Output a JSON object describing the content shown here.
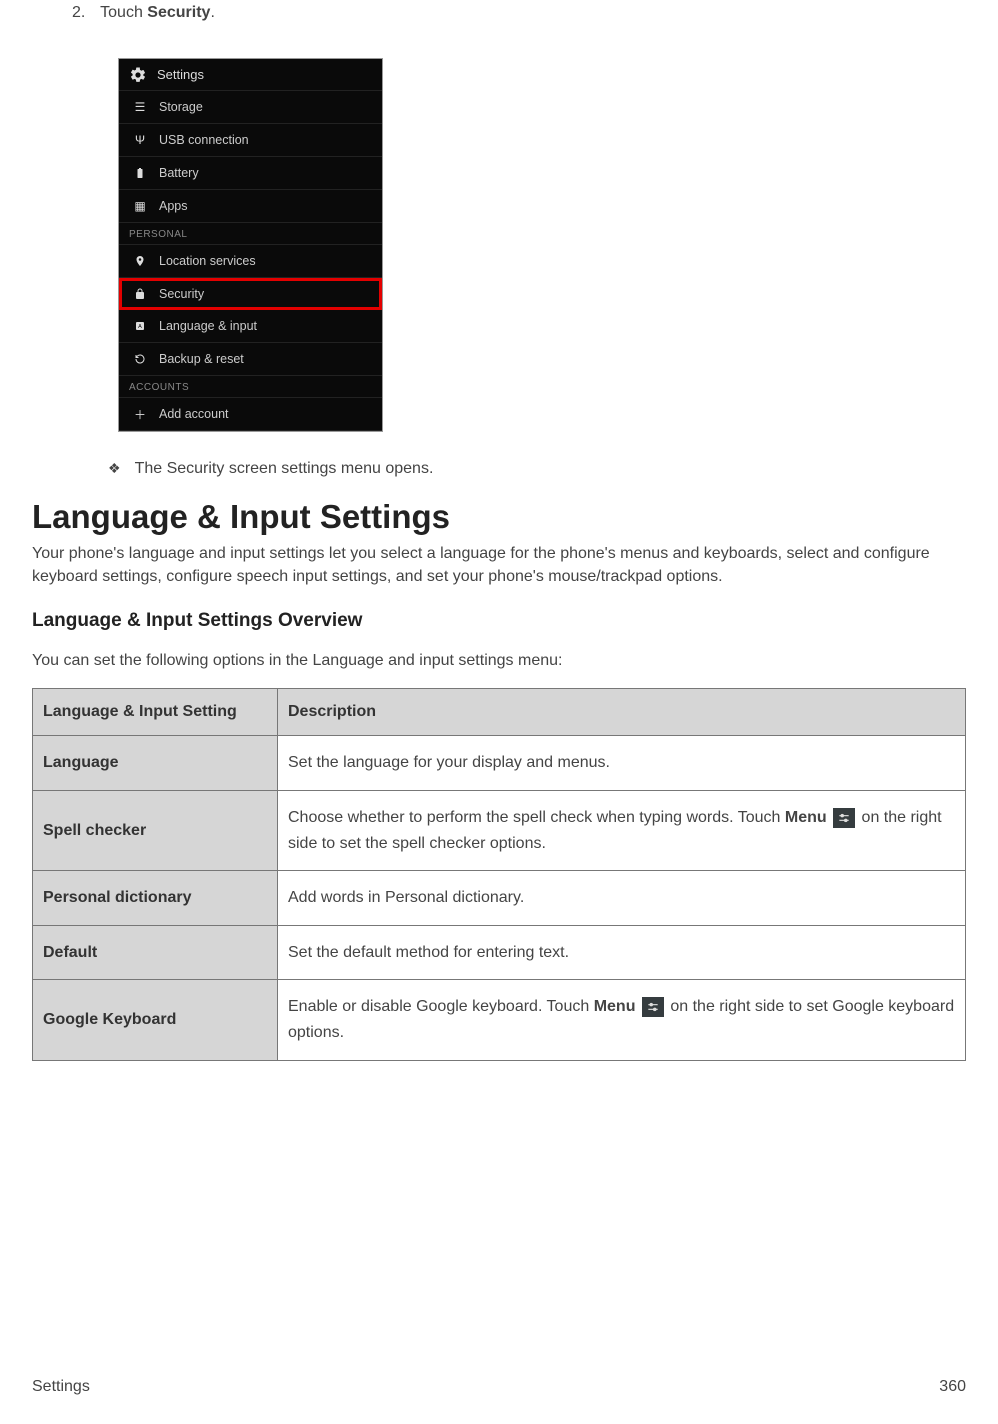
{
  "step": {
    "num": "2.",
    "prefix": "Touch ",
    "bold": "Security",
    "suffix": "."
  },
  "screenshot": {
    "title": "Settings",
    "rows": [
      {
        "icon": "storage-icon",
        "label": "Storage"
      },
      {
        "icon": "usb-icon",
        "label": "USB connection"
      },
      {
        "icon": "battery-icon",
        "label": "Battery"
      },
      {
        "icon": "apps-icon",
        "label": "Apps"
      }
    ],
    "section1": "PERSONAL",
    "rows2": [
      {
        "icon": "location-icon",
        "label": "Location services"
      },
      {
        "icon": "lock-icon",
        "label": "Security",
        "highlight": true
      },
      {
        "icon": "language-icon",
        "label": "Language & input"
      },
      {
        "icon": "backup-icon",
        "label": "Backup & reset"
      }
    ],
    "section2": "ACCOUNTS",
    "rows3": [
      {
        "icon": "plus-icon",
        "label": "Add account"
      }
    ]
  },
  "bullet": "The Security screen settings menu opens.",
  "h1": "Language & Input Settings",
  "intro": "Your phone's language and input settings let you select a language for the phone's menus and keyboards, select and configure keyboard settings, configure speech input settings, and set your phone's mouse/trackpad options.",
  "h2": "Language & Input Settings Overview",
  "lead": "You can set the following options in the Language and input settings menu:",
  "table": {
    "h1": "Language & Input Setting",
    "h2": "Description",
    "rows": [
      {
        "name": "Language",
        "desc": "Set the language for your display and menus."
      },
      {
        "name": "Spell checker",
        "pre": "Choose whether to perform the spell check when typing words. Touch ",
        "bold": "Menu",
        "post": " on the right side to set the spell checker options."
      },
      {
        "name": "Personal dictionary",
        "desc": "Add words in Personal dictionary."
      },
      {
        "name": "Default",
        "desc": "Set the default method for entering text."
      },
      {
        "name": "Google Keyboard",
        "pre": "Enable or disable Google keyboard. Touch ",
        "bold": "Menu",
        "post": " on the right side to set Google keyboard options."
      }
    ]
  },
  "footer": {
    "left": "Settings",
    "right": "360"
  }
}
